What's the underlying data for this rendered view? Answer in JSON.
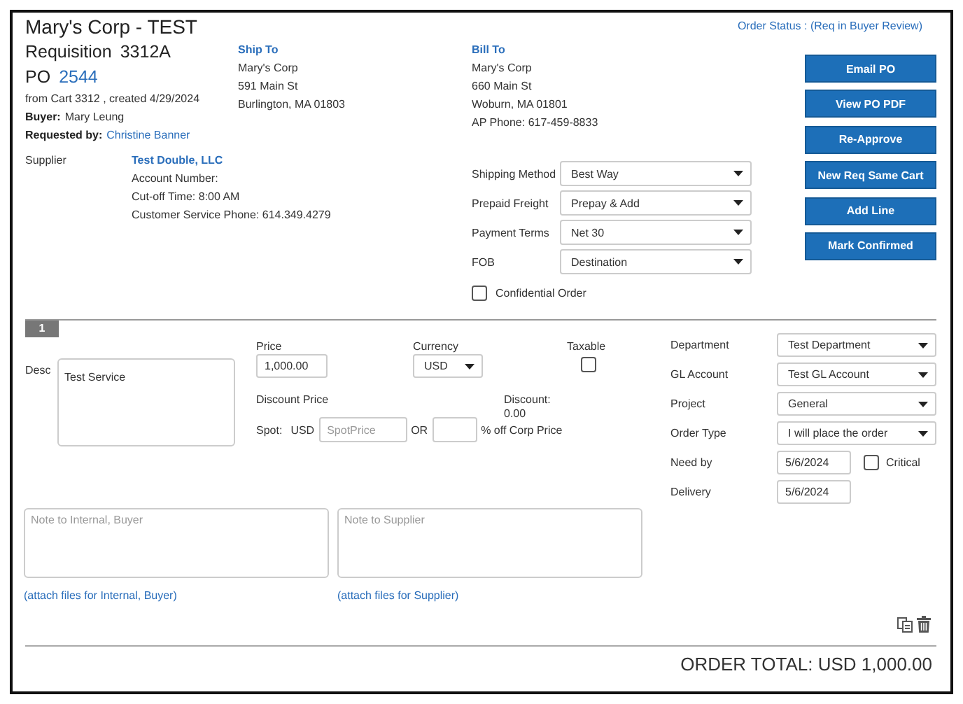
{
  "header": {
    "title": "Mary's Corp - TEST",
    "requisition_label": "Requisition",
    "requisition": "3312A",
    "po_label": "PO",
    "po": "2544",
    "created": "from Cart 3312 , created 4/29/2024",
    "buyer_label": "Buyer:",
    "buyer": "Mary Leung",
    "requested_label": "Requested by:",
    "requested_by": "Christine Banner"
  },
  "ship_to": {
    "heading": "Ship To",
    "lines": [
      "Mary's Corp",
      "591 Main St",
      "Burlington, MA 01803"
    ]
  },
  "bill_to": {
    "heading": "Bill To",
    "lines": [
      "Mary's Corp",
      "660 Main St",
      "Woburn, MA 01801",
      "AP Phone: 617-459-8833"
    ]
  },
  "order_status": "Order Status : (Req in Buyer Review)",
  "buttons": [
    "Email PO",
    "View PO PDF",
    "Re-Approve",
    "New Req Same Cart",
    "Add Line",
    "Mark Confirmed"
  ],
  "supplier": {
    "label": "Supplier",
    "name": "Test Double, LLC",
    "lines": [
      "Account Number:",
      "Cut-off Time: 8:00 AM",
      "Customer Service Phone: 614.349.4279"
    ]
  },
  "order_fields": [
    {
      "label": "Shipping Method",
      "value": "Best Way"
    },
    {
      "label": "Prepaid Freight",
      "value": "Prepay & Add"
    },
    {
      "label": "Payment Terms",
      "value": "Net 30"
    },
    {
      "label": "FOB",
      "value": "Destination"
    }
  ],
  "confidential": {
    "label": "Confidential Order",
    "checked": false
  },
  "line": {
    "number": "1",
    "desc_label": "Desc",
    "desc": "Test Service",
    "price_label": "Price",
    "price": "1,000.00",
    "currency_label": "Currency",
    "currency": "USD",
    "taxable_label": "Taxable",
    "taxable": false,
    "discount_price_label": "Discount Price",
    "discount_label": "Discount:",
    "discount": "0.00",
    "spot_label": "Spot:",
    "spot_currency": "USD",
    "spot_placeholder": "SpotPrice",
    "or_label": "OR",
    "percent_label": "% off Corp Price",
    "fields": [
      {
        "kind": "select",
        "label": "Department",
        "value": "Test Department"
      },
      {
        "kind": "select",
        "label": "GL Account",
        "value": "Test GL Account"
      },
      {
        "kind": "select",
        "label": "Project",
        "value": "General"
      },
      {
        "kind": "select",
        "label": "Order Type",
        "value": "I will place the order"
      },
      {
        "kind": "date",
        "label": "Need by",
        "value": "5/6/2024",
        "critical": {
          "label": "Critical",
          "checked": false
        }
      },
      {
        "kind": "date",
        "label": "Delivery",
        "value": "5/6/2024"
      }
    ],
    "notes": [
      {
        "placeholder": "Note to Internal, Buyer",
        "attach": "(attach files for Internal, Buyer)"
      },
      {
        "placeholder": "Note to Supplier",
        "attach": "(attach files for Supplier)"
      }
    ]
  },
  "order_total": "ORDER TOTAL: USD 1,000.00"
}
